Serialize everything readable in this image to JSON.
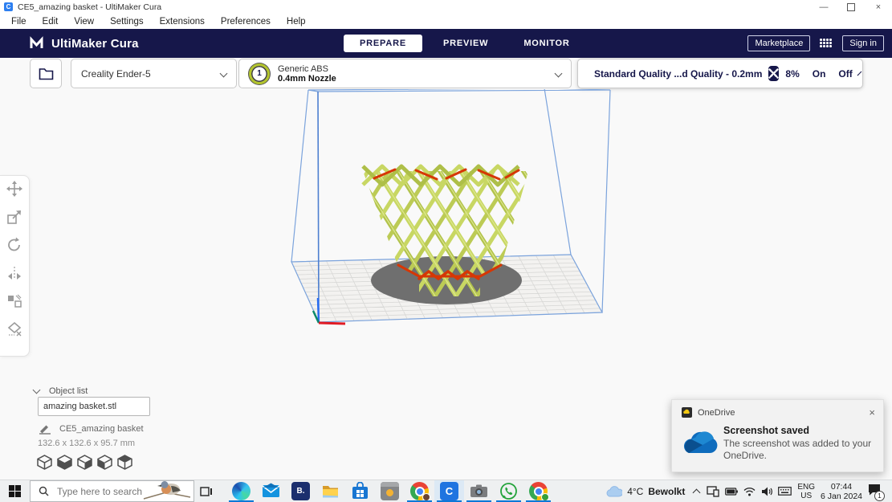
{
  "window": {
    "title": "CE5_amazing basket - UltiMaker Cura",
    "minimize_glyph": "—",
    "close_glyph": "×"
  },
  "menu": {
    "items": [
      "File",
      "Edit",
      "View",
      "Settings",
      "Extensions",
      "Preferences",
      "Help"
    ]
  },
  "header": {
    "app_name": "UltiMaker Cura",
    "tabs": [
      "PREPARE",
      "PREVIEW",
      "MONITOR"
    ],
    "marketplace": "Marketplace",
    "sign_in": "Sign in"
  },
  "config": {
    "printer_name": "Creality Ender-5",
    "extruder_number": "1",
    "material_name": "Generic ABS",
    "nozzle_size": "0.4mm Nozzle",
    "profile": "Standard Quality ...d Quality - 0.2mm",
    "infill": "8%",
    "support": "On",
    "adhesion": "Off"
  },
  "object_panel": {
    "list_label": "Object list",
    "filename": "amazing basket.stl",
    "object_name": "CE5_amazing basket",
    "dimensions": "132.6 x 132.6 x 95.7 mm"
  },
  "toast": {
    "app": "OneDrive",
    "title": "Screenshot saved",
    "body": "The screenshot was added to your OneDrive.",
    "close_glyph": "×"
  },
  "taskbar": {
    "search_placeholder": "Type here to search",
    "booking_letter": "B.",
    "cura_letter": "C",
    "weather_temp": "4°C",
    "weather_desc": "Bewolkt",
    "lang_top": "ENG",
    "lang_bottom": "US",
    "time": "07:44",
    "date": "6 Jan 2024",
    "badge_count": "1"
  },
  "colors": {
    "header_navy": "#16174a",
    "model_green": "#c8d763",
    "model_green_dark": "#b2c34c",
    "model_red": "#d63705",
    "build_line": "#7ba3dc",
    "shadow_gray": "#6f6f6f",
    "underline_blue": "#0b78d7"
  }
}
